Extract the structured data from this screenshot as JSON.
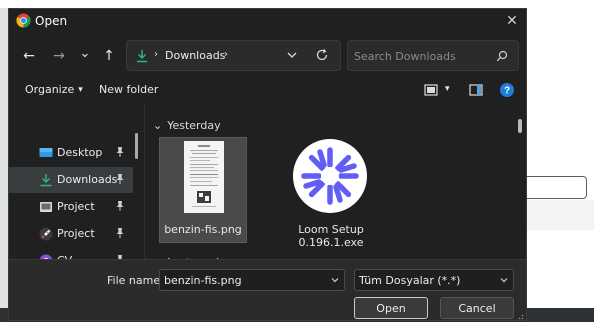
{
  "window": {
    "title": "Open",
    "close_glyph": "✕"
  },
  "nav": {
    "back_glyph": "←",
    "forward_glyph": "→",
    "recent_glyph": "⌄",
    "up_glyph": "↑",
    "breadcrumb_sep": "›",
    "breadcrumb": [
      "Downloads"
    ],
    "search_placeholder": "Search Downloads"
  },
  "toolbar": {
    "organize_label": "Organize",
    "organize_chevron": "▾",
    "new_folder_label": "New folder",
    "view_chevron": "▾"
  },
  "sidebar": {
    "items": [
      {
        "label": "Desktop",
        "icon": "desktop-icon",
        "pinned": true,
        "active": false
      },
      {
        "label": "Downloads",
        "icon": "download-icon",
        "pinned": true,
        "active": true
      },
      {
        "label": "Project",
        "icon": "image-folder-icon",
        "pinned": true,
        "active": false
      },
      {
        "label": "Project",
        "icon": "rocket-icon",
        "pinned": true,
        "active": false
      },
      {
        "label": "CV",
        "icon": "app-icon",
        "pinned": true,
        "active": false
      }
    ]
  },
  "files": {
    "groups": [
      {
        "label": "Yesterday",
        "glyph": "⌄"
      },
      {
        "label": "Last week",
        "glyph": "⌄"
      }
    ],
    "items": [
      {
        "label": "benzin-fis.png",
        "type": "image",
        "selected": true
      },
      {
        "label_line1": "Loom Setup",
        "label_line2": "0.196.1.exe",
        "type": "exe",
        "selected": false
      }
    ]
  },
  "footer": {
    "file_name_label": "File name:",
    "file_name_value": "benzin-fis.png",
    "file_type_value": "Tüm Dosyalar (*.*)",
    "open_label": "Open",
    "cancel_label": "Cancel"
  },
  "colors": {
    "accent": "#0078d4",
    "download_green": "#2fb47a",
    "loom_purple": "#625df5"
  }
}
